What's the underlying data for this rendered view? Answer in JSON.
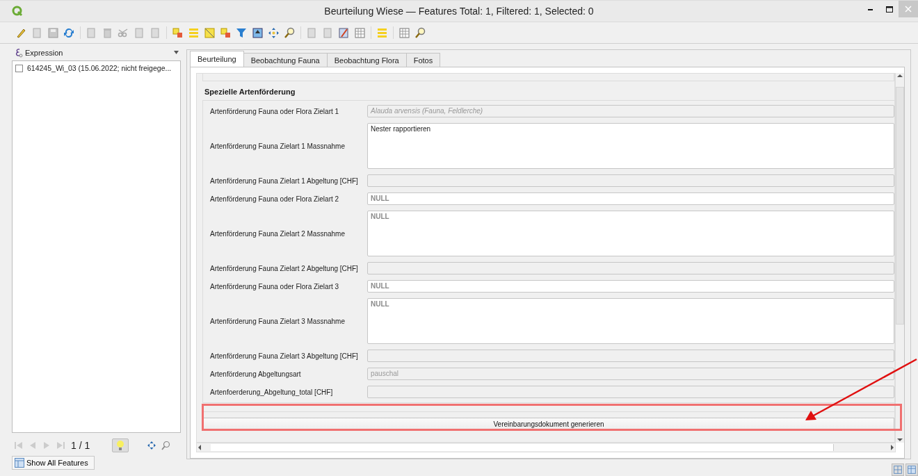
{
  "window": {
    "title": "Beurteilung Wiese — Features Total: 1, Filtered: 1, Selected: 0"
  },
  "expression_field": {
    "label": "Expression"
  },
  "feature_list": [
    {
      "label": "614245_Wi_03 (15.06.2022; nicht freigege...",
      "checked": false
    }
  ],
  "navigation": {
    "counter": "1 / 1",
    "highlight_on": true
  },
  "filter_button": {
    "label": "Show All Features"
  },
  "tabs": [
    {
      "label": "Beurteilung",
      "selected": true
    },
    {
      "label": "Beobachtung Fauna",
      "selected": false
    },
    {
      "label": "Beobachtung Flora",
      "selected": false
    },
    {
      "label": "Fotos",
      "selected": false
    }
  ],
  "section": {
    "title": "Spezielle Artenförderung"
  },
  "fields": [
    {
      "label": "Artenförderung Fauna oder Flora Zielart 1",
      "kind": "combo",
      "disabled": true,
      "is_null": false,
      "value": "Alauda arvensis (Fauna, Feldlerche)"
    },
    {
      "label": "Artenförderung Fauna Zielart 1 Massnahme",
      "kind": "multiline",
      "disabled": false,
      "is_null": false,
      "value": "Nester rapportieren"
    },
    {
      "label": "Artenförderung Fauna Zielart 1 Abgeltung [CHF]",
      "kind": "line",
      "disabled": true,
      "is_null": false
    },
    {
      "label": "Artenförderung Fauna oder Flora Zielart 2",
      "kind": "line",
      "disabled": false,
      "is_null": true,
      "value": "NULL"
    },
    {
      "label": "Artenförderung Fauna Zielart 2 Massnahme",
      "kind": "multiline",
      "disabled": false,
      "is_null": true,
      "value": "NULL"
    },
    {
      "label": "Artenförderung Fauna Zielart 2 Abgeltung [CHF]",
      "kind": "line",
      "disabled": true,
      "is_null": false
    },
    {
      "label": "Artenförderung Fauna oder Flora Zielart 3",
      "kind": "line",
      "disabled": false,
      "is_null": true,
      "value": "NULL"
    },
    {
      "label": "Artenförderung Fauna Zielart 3 Massnahme",
      "kind": "multiline",
      "disabled": false,
      "is_null": true,
      "value": "NULL"
    },
    {
      "label": "Artenförderung Fauna Zielart 3 Abgeltung [CHF]",
      "kind": "line",
      "disabled": true,
      "is_null": false
    },
    {
      "label": "Artenförderung Abgeltungsart",
      "kind": "line",
      "disabled": true,
      "is_null": false,
      "value": "pauschal"
    },
    {
      "label": "Artenfoerderung_Abgeltung_total [CHF]",
      "kind": "line",
      "disabled": true,
      "is_null": false
    }
  ],
  "action_button": {
    "label": "Vereinbarungsdokument generieren"
  }
}
